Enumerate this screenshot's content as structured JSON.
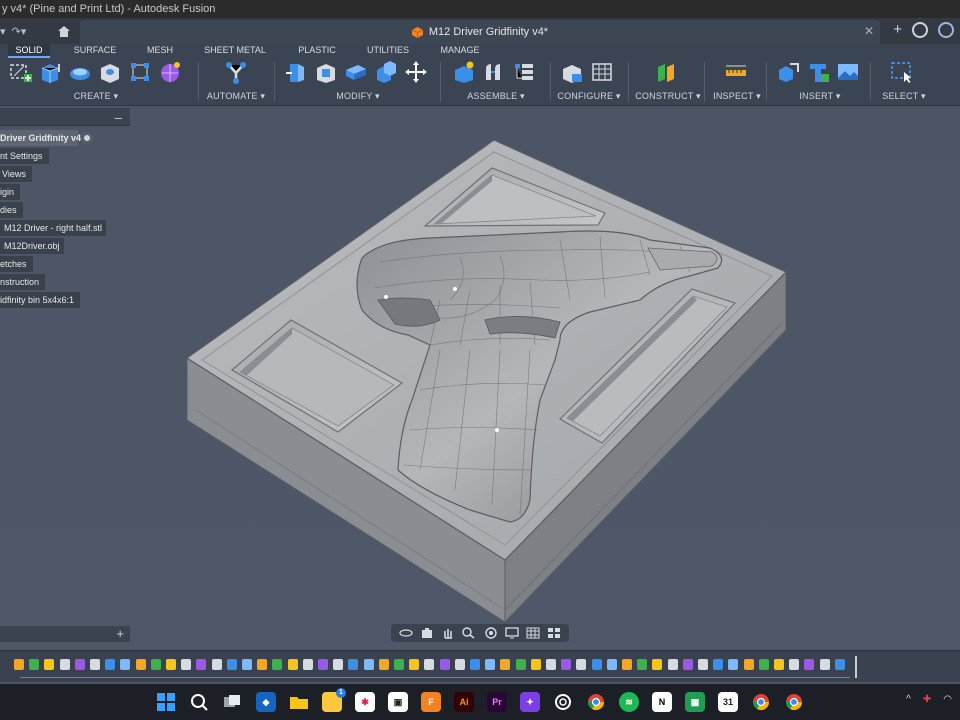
{
  "window": {
    "title": "y v4* (Pine and Print Ltd) - Autodesk Fusion"
  },
  "document": {
    "tab_title": "M12 Driver Gridfinity v4*"
  },
  "colors": {
    "toolbar_bg": "#3a4452",
    "viewport_bg": "#4a5566",
    "model_grey": "#9b9ea2",
    "accent_blue": "#4b9cff",
    "fusion_orange": "#f58220"
  },
  "workspace_tabs": [
    "SOLID",
    "SURFACE",
    "MESH",
    "SHEET METAL",
    "PLASTIC",
    "UTILITIES",
    "MANAGE"
  ],
  "active_workspace_tab": "SOLID",
  "toolbar_groups": {
    "create": "CREATE",
    "automate": "AUTOMATE",
    "modify": "MODIFY",
    "assemble": "ASSEMBLE",
    "configure": "CONFIGURE",
    "construct": "CONSTRUCT",
    "inspect": "INSPECT",
    "insert": "INSERT",
    "select": "SELECT"
  },
  "browser": {
    "root": "Driver Gridfinity v4",
    "nodes": [
      "nt Settings",
      "Views",
      "igin",
      "dies",
      "M12 Driver - right half.stl",
      "M12Driver.obj",
      "etches",
      "nstruction",
      "idfinity bin 5x4x6:1"
    ]
  },
  "taskbar": {
    "calendar_day": "31",
    "notification_count": "1"
  }
}
